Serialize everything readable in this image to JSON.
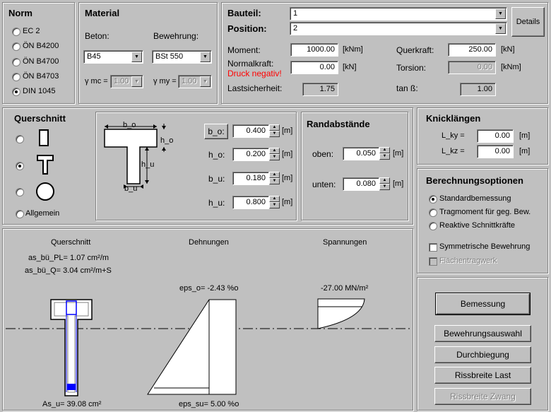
{
  "norm": {
    "title": "Norm",
    "options": [
      "EC 2",
      "ÖN B4200",
      "ÖN B4700",
      "ÖN B4703",
      "DIN 1045"
    ],
    "selected": 4
  },
  "material": {
    "title": "Material",
    "beton_label": "Beton:",
    "bewehrung_label": "Bewehrung:",
    "beton_value": "B45",
    "bewehrung_value": "BSt 550",
    "gamma_mc_label": "γ mc =",
    "gamma_mc_value": "1.00",
    "gamma_my_label": "γ my =",
    "gamma_my_value": "1.00"
  },
  "bauteil": {
    "bauteil_label": "Bauteil:",
    "bauteil_value": "1",
    "position_label": "Position:",
    "position_value": "2",
    "details_label": "Details",
    "moment_label": "Moment:",
    "moment_value": "1000.00",
    "moment_unit": "[kNm]",
    "normalkraft_label": "Normalkraft:",
    "normalkraft_value": "0.00",
    "normalkraft_unit": "[kN]",
    "druck_note": "Druck negativ!",
    "lastsicherheit_label": "Lastsicherheit:",
    "lastsicherheit_value": "1.75",
    "querkraft_label": "Querkraft:",
    "querkraft_value": "250.00",
    "querkraft_unit": "[kN]",
    "torsion_label": "Torsion:",
    "torsion_value": "0.00",
    "torsion_unit": "[kNm]",
    "tanb_label": "tan ß:",
    "tanb_value": "1.00"
  },
  "querschnitt": {
    "title": "Querschnitt",
    "allgemein_label": "Allgemein",
    "selected": 1,
    "dims": [
      {
        "label": "b_o:",
        "value": "0.400",
        "unit": "[m]"
      },
      {
        "label": "h_o:",
        "value": "0.200",
        "unit": "[m]"
      },
      {
        "label": "b_u:",
        "value": "0.180",
        "unit": "[m]"
      },
      {
        "label": "h_u:",
        "value": "0.800",
        "unit": "[m]"
      }
    ],
    "sketch": {
      "b_o": "b_o",
      "h_o": "h_o",
      "h_u": "h_u",
      "b_u": "b_u"
    }
  },
  "randabstaende": {
    "title": "Randabstände",
    "oben_label": "oben:",
    "oben_value": "0.050",
    "unten_label": "unten:",
    "unten_value": "0.080",
    "unit": "[m]"
  },
  "knicklaengen": {
    "title": "Knicklängen",
    "lky_label": "L_ky =",
    "lky_value": "0.00",
    "lkz_label": "L_kz =",
    "lkz_value": "0.00",
    "unit": "[m]"
  },
  "optionen": {
    "title": "Berechnungsoptionen",
    "radios": [
      "Standardbemessung",
      "Tragmoment für geg. Bew.",
      "Reaktive Schnittkräfte"
    ],
    "selected": 0,
    "symmetrisch_label": "Symmetrische Bewehrung",
    "flaechen_label": "Flächentragwerk"
  },
  "results": {
    "querschnitt_head": "Querschnitt",
    "dehnungen_head": "Dehnungen",
    "spannungen_head": "Spannungen",
    "as_bu_pl": "as_bü_PL=  1.07 cm²/m",
    "as_bu_q": "as_bü_Q=  3.04 cm²/m+S",
    "eps_o": "eps_o= -2.43 %o",
    "eps_su": "eps_su= 5.00 %o",
    "stress": "-27.00 MN/m²",
    "as_u": "As_u=  39.08 cm²"
  },
  "actions": {
    "bemessung": "Bemessung",
    "bewehrungsauswahl": "Bewehrungsauswahl",
    "durchbiegung": "Durchbiegung",
    "rissbreite_last": "Rissbreite Last",
    "rissbreite_zwang": "Rissbreite Zwang"
  }
}
